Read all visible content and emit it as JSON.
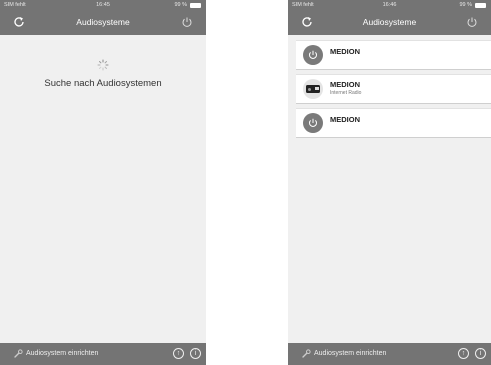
{
  "status_bar": {
    "carrier": "SIM fehlt",
    "time_left": "16:45",
    "time_right": "16:46",
    "battery": "99 %"
  },
  "navbar": {
    "title": "Audiosysteme"
  },
  "loading": {
    "text": "Suche nach Audiosystemen"
  },
  "devices": [
    {
      "name": "MEDION",
      "subtitle": "",
      "icon": "power-icon"
    },
    {
      "name": "MEDION",
      "subtitle": "Internet Radio",
      "icon": "radio-icon"
    },
    {
      "name": "MEDION",
      "subtitle": "",
      "icon": "power-icon"
    }
  ],
  "bottom_bar": {
    "setup_label": "Audiosystem einrichten",
    "upload_symbol": "↑",
    "info_symbol": "i"
  },
  "colors": {
    "bar": "#747474",
    "background": "#f0f0f0",
    "row": "#ffffff"
  }
}
